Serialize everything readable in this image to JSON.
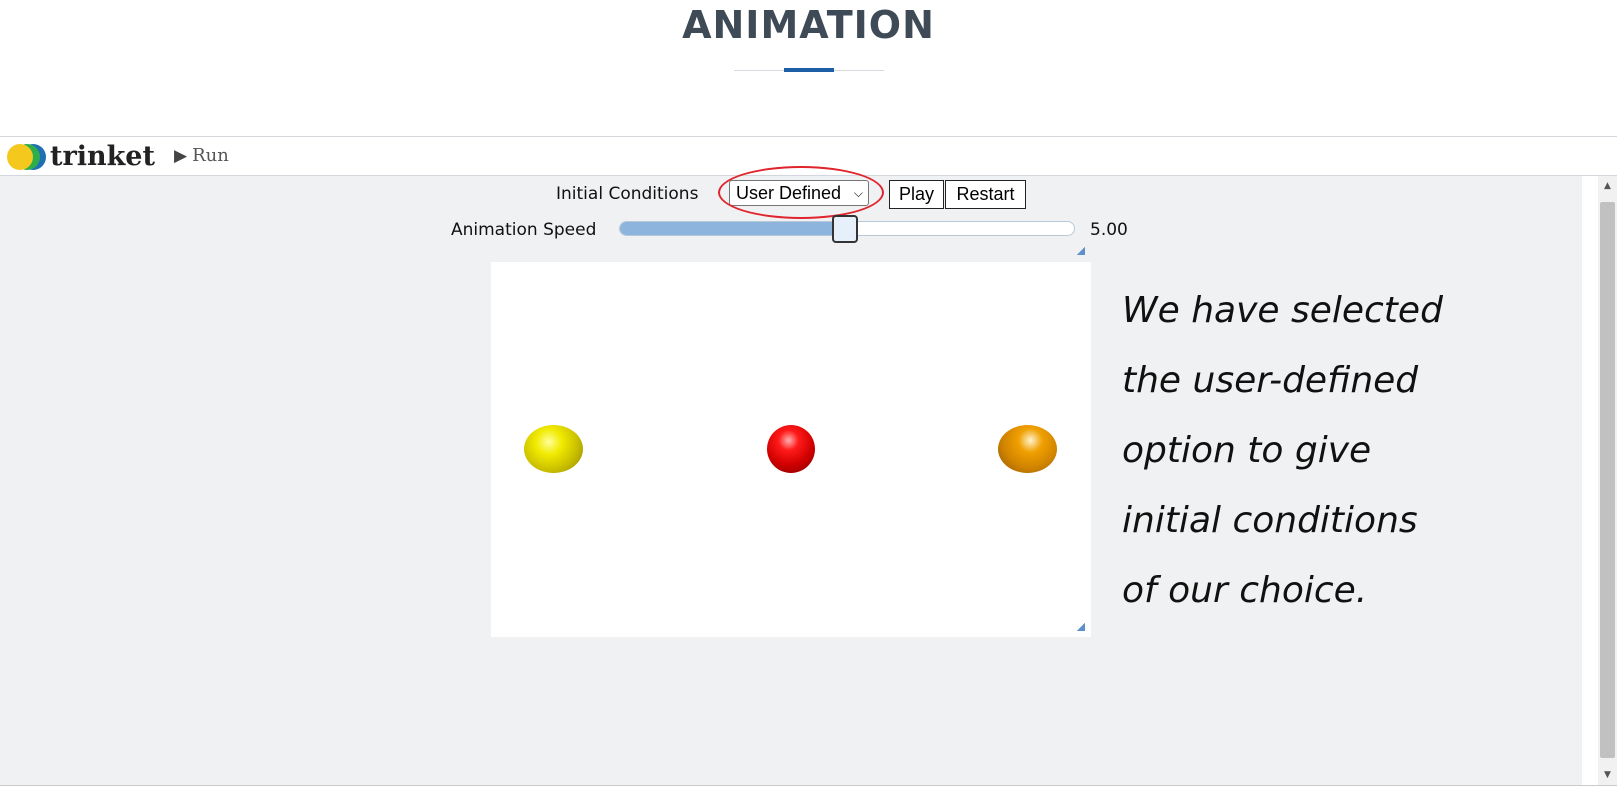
{
  "page": {
    "title": "ANIMATION"
  },
  "topbar": {
    "logo_text": "trinket",
    "run_label": "Run"
  },
  "controls": {
    "initial_conditions_label": "Initial Conditions",
    "initial_conditions_value": "User Defined",
    "play_label": "Play",
    "restart_label": "Restart",
    "speed_label": "Animation Speed",
    "speed_value": "5.00",
    "speed_fraction": 0.5
  },
  "scene": {
    "balls": [
      {
        "color": "yellow",
        "hex": "#e8e000"
      },
      {
        "color": "red",
        "hex": "#d10000"
      },
      {
        "color": "orange",
        "hex": "#d98a00"
      }
    ]
  },
  "annotation": {
    "lines": [
      "We have selected",
      "the user-defined",
      "option to give",
      "initial conditions",
      "of our choice."
    ]
  },
  "colors": {
    "accent": "#1d5fa7",
    "highlight": "#e0242c",
    "slider_fill": "#8db4dc",
    "app_background": "#f0f1f2"
  }
}
